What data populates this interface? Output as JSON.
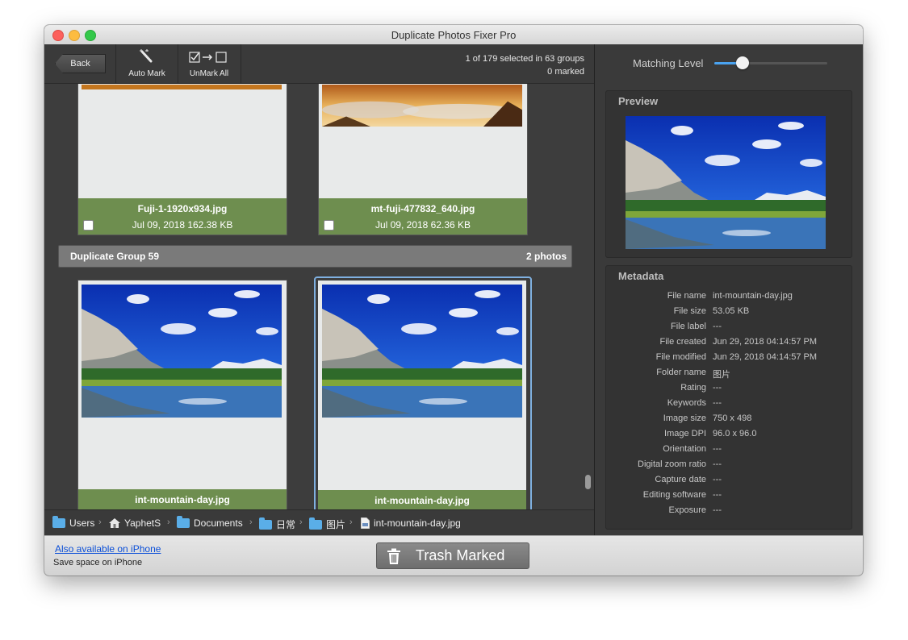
{
  "window": {
    "title": "Duplicate Photos Fixer Pro"
  },
  "toolbar": {
    "back_label": "Back",
    "auto_mark_label": "Auto Mark",
    "unmark_all_label": "UnMark All",
    "selection_status": "1 of 179 selected in 63 groups",
    "marked_status": "0 marked"
  },
  "prev_group": {
    "photos": [
      {
        "name": "Fuji-1-1920x934.jpg",
        "meta": "Jul 09, 2018  162.38 KB",
        "checked": false
      },
      {
        "name": "mt-fuji-477832_640.jpg",
        "meta": "Jul 09, 2018  62.36 KB",
        "checked": false
      }
    ]
  },
  "group": {
    "name": "Duplicate Group 59",
    "count": "2 photos",
    "photos": [
      {
        "name": "int-mountain-day.jpg",
        "selected": false
      },
      {
        "name": "int-mountain-day.jpg",
        "selected": true
      }
    ]
  },
  "path": {
    "items": [
      {
        "label": "Users",
        "icon": "folder-icon"
      },
      {
        "label": "YaphetS",
        "icon": "home-icon"
      },
      {
        "label": "Documents",
        "icon": "folder-icon"
      },
      {
        "label": "日常",
        "icon": "folder-icon"
      },
      {
        "label": "图片",
        "icon": "folder-icon"
      },
      {
        "label": "int-mountain-day.jpg",
        "icon": "file-icon"
      }
    ]
  },
  "matching": {
    "label": "Matching Level",
    "level": 0.25
  },
  "preview": {
    "title": "Preview"
  },
  "metadata": {
    "title": "Metadata",
    "rows": [
      {
        "key": "File name",
        "value": "int-mountain-day.jpg"
      },
      {
        "key": "File size",
        "value": "53.05 KB"
      },
      {
        "key": "File label",
        "value": "---"
      },
      {
        "key": "File created",
        "value": "Jun 29, 2018 04:14:57 PM"
      },
      {
        "key": "File modified",
        "value": "Jun 29, 2018 04:14:57 PM"
      },
      {
        "key": "Folder name",
        "value": "图片"
      },
      {
        "key": "Rating",
        "value": "---"
      },
      {
        "key": "Keywords",
        "value": "---"
      },
      {
        "key": "Image size",
        "value": "750 x 498"
      },
      {
        "key": "Image DPI",
        "value": "96.0 x 96.0"
      },
      {
        "key": "Orientation",
        "value": "---"
      },
      {
        "key": "Digital zoom ratio",
        "value": "---"
      },
      {
        "key": "Capture date",
        "value": "---"
      },
      {
        "key": "Editing software",
        "value": "---"
      },
      {
        "key": "Exposure",
        "value": "---"
      }
    ]
  },
  "bottom": {
    "iphone_link": "Also available on iPhone",
    "iphone_sub": "Save space on iPhone",
    "trash_label": "Trash Marked"
  },
  "colors": {
    "accent": "#4aa3f0",
    "card_footer": "#6e8e4f",
    "link": "#0b4fd8"
  }
}
